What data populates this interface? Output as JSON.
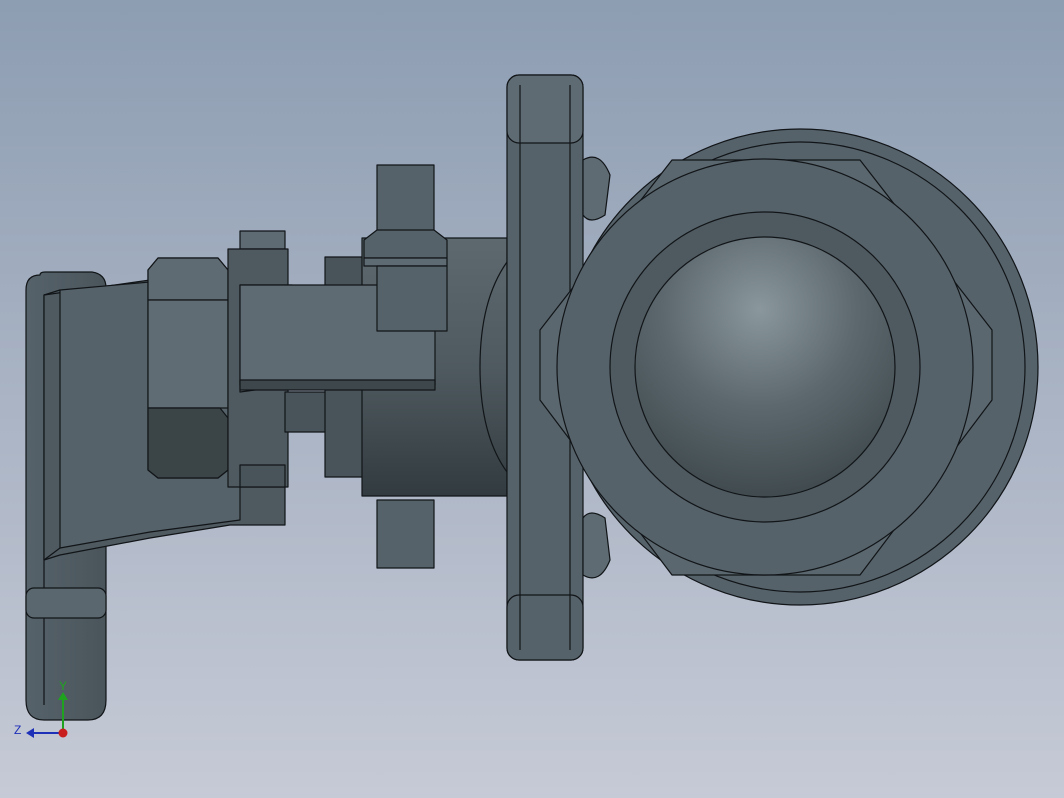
{
  "viewport": {
    "background_top": "#8d9db2",
    "background_bottom": "#c6cad6"
  },
  "model": {
    "body_color": "#56626a",
    "dark_color": "#3b4548",
    "light_color": "#6e7b82",
    "edge_color": "#111518"
  },
  "triad": {
    "y_label": "Y",
    "z_label": "Z",
    "y_color": "#1fa31f",
    "z_color": "#1e2fb8",
    "x_color": "#c81e1e"
  }
}
